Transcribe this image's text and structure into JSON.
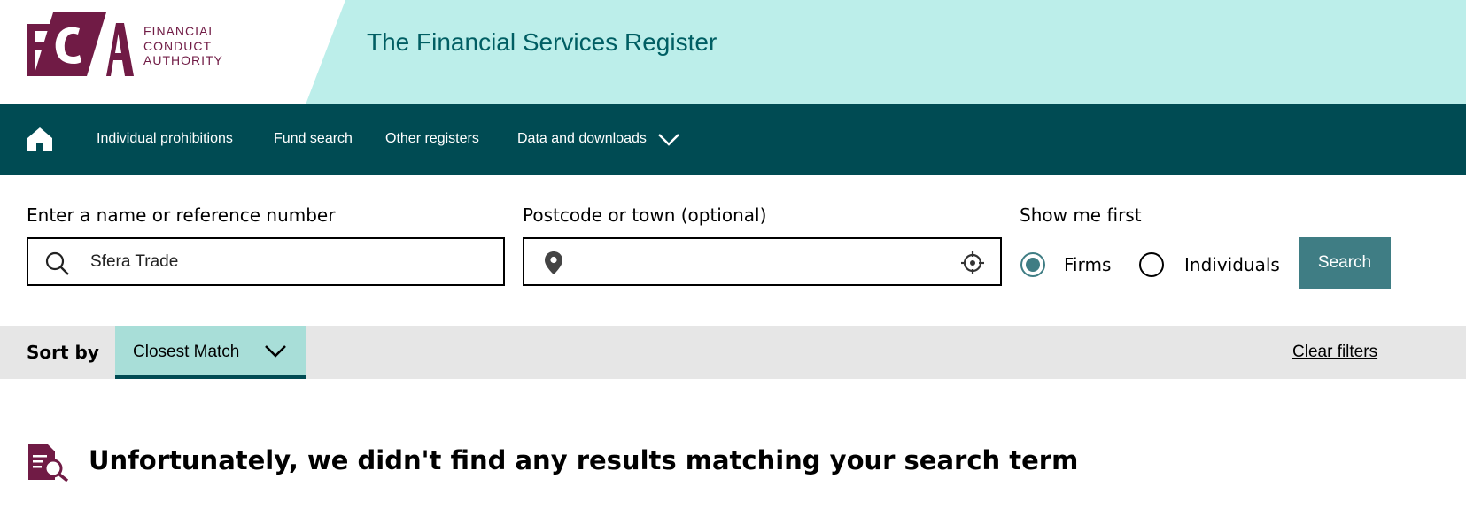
{
  "header": {
    "logo": {
      "letters": "FCA",
      "lines": [
        "FINANCIAL",
        "CONDUCT",
        "AUTHORITY"
      ]
    },
    "title": "The Financial Services Register"
  },
  "nav": {
    "items": [
      {
        "label": "Individual prohibitions"
      },
      {
        "label": "Fund search"
      },
      {
        "label": "Other registers"
      },
      {
        "label": "Data and downloads"
      }
    ]
  },
  "search": {
    "name_label": "Enter a name or reference number",
    "name_value": "Sfera Trade",
    "postcode_label": "Postcode or town (optional)",
    "postcode_value": "",
    "show_label": "Show me first",
    "options": [
      {
        "label": "Firms",
        "selected": true
      },
      {
        "label": "Individuals",
        "selected": false
      }
    ],
    "button": "Search"
  },
  "sort": {
    "label": "Sort by",
    "value": "Closest Match",
    "clear": "Clear filters"
  },
  "results": {
    "message": "Unfortunately, we didn't find any results matching your search term"
  },
  "colors": {
    "brand": "#701b45",
    "nav_bg": "#004b53",
    "header_bg": "#bceeea",
    "accent": "#3f7d84",
    "sort_bg": "#a8ded8"
  }
}
